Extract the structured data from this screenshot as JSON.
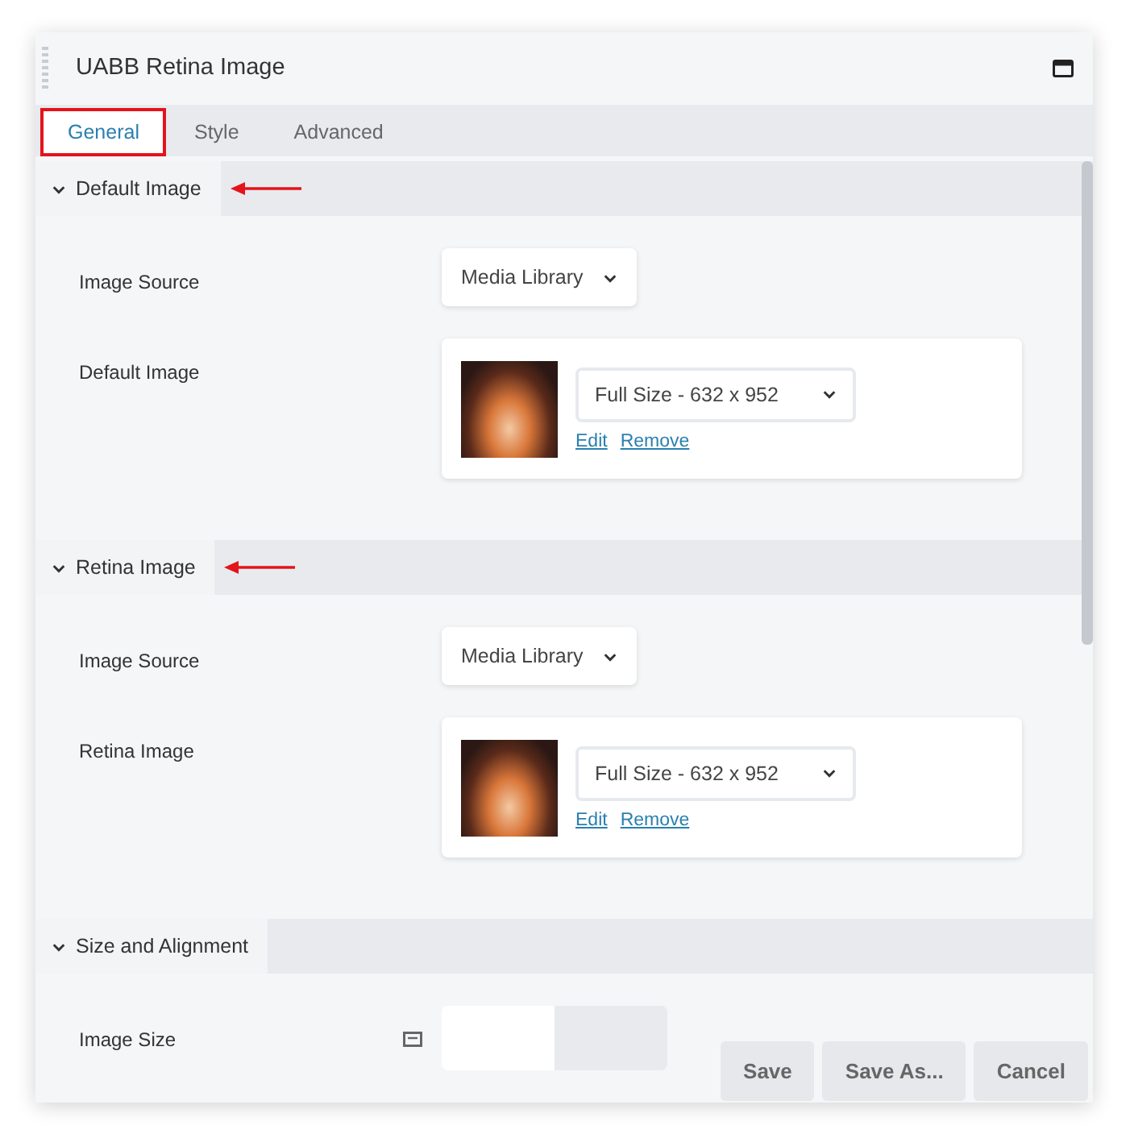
{
  "panel": {
    "title": "UABB Retina Image",
    "tabs": [
      {
        "label": "General",
        "selected": true,
        "highlighted": true
      },
      {
        "label": "Style",
        "selected": false,
        "highlighted": false
      },
      {
        "label": "Advanced",
        "selected": false,
        "highlighted": false
      }
    ],
    "sections": [
      {
        "title": "Default Image",
        "expanded": true,
        "annotated": true,
        "fields": [
          {
            "kind": "select",
            "label": "Image Source",
            "value": "Media Library"
          },
          {
            "kind": "image",
            "label": "Default Image",
            "value": "Full Size - 632 x 952",
            "links": [
              "Edit",
              "Remove"
            ]
          }
        ]
      },
      {
        "title": "Retina Image",
        "expanded": true,
        "annotated": true,
        "fields": [
          {
            "kind": "select",
            "label": "Image Source",
            "value": "Media Library"
          },
          {
            "kind": "image",
            "label": "Retina Image",
            "value": "Full Size - 632 x 952",
            "links": [
              "Edit",
              "Remove"
            ]
          }
        ]
      },
      {
        "title": "Size and Alignment",
        "expanded": true,
        "annotated": false,
        "fields": [
          {
            "kind": "toggle",
            "label": "Image Size"
          }
        ]
      }
    ],
    "buttons": [
      "Save",
      "Save As...",
      "Cancel"
    ]
  }
}
